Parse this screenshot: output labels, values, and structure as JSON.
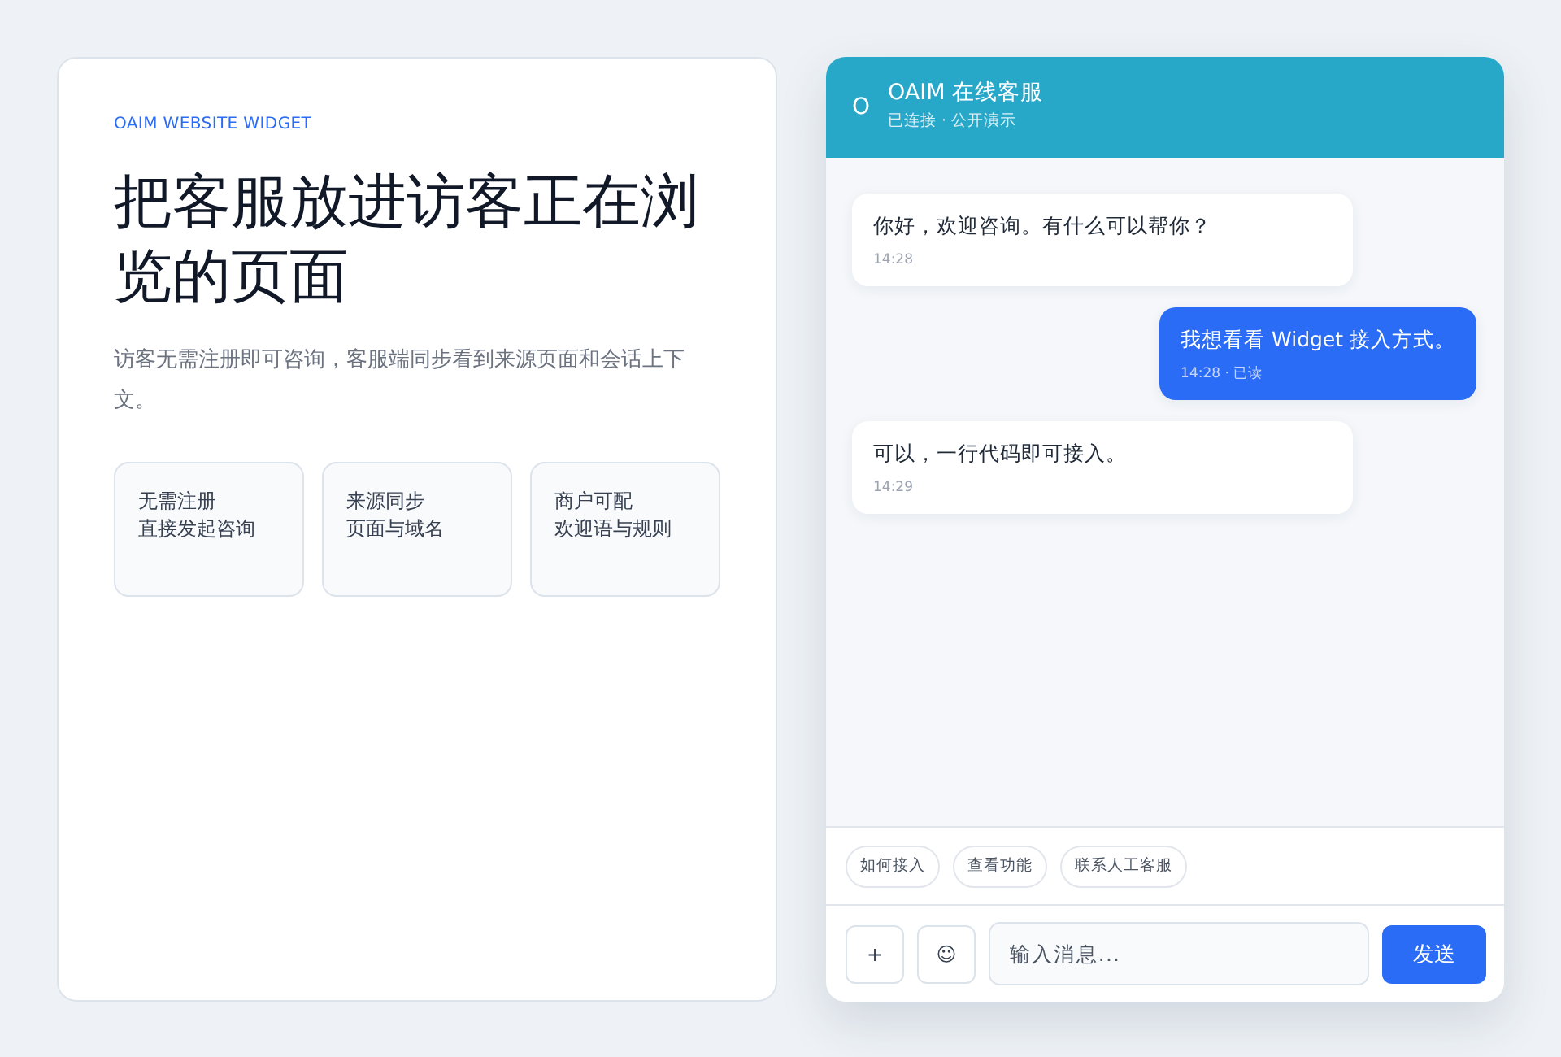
{
  "intro": {
    "eyebrow": "OAIM WEBSITE WIDGET",
    "title": "把客服放进访客正在浏览的页面",
    "description": "访客无需注册即可咨询，客服端同步看到来源页面和会话上下文。",
    "features": [
      {
        "title": "无需注册",
        "detail": "直接发起咨询"
      },
      {
        "title": "来源同步",
        "detail": "页面与域名"
      },
      {
        "title": "商户可配",
        "detail": "欢迎语与规则"
      }
    ]
  },
  "widget": {
    "header": {
      "logo": "O",
      "title": "OAIM 在线客服",
      "status": "已连接 · 公开演示"
    },
    "messages": [
      {
        "kind": "agent",
        "text": "你好，欢迎咨询。有什么可以帮你？",
        "meta": "14:28"
      },
      {
        "kind": "user",
        "text": "我想看看 Widget 接入方式。",
        "meta": "14:28 · 已读"
      },
      {
        "kind": "agent",
        "text": "可以，一行代码即可接入。",
        "meta": "14:29"
      }
    ],
    "quick_replies": [
      "如何接入",
      "查看功能",
      "联系人工客服"
    ],
    "composer": {
      "attach_button": "+",
      "emoji_button": "☺",
      "placeholder": "输入消息...",
      "send_button": "发送"
    }
  }
}
